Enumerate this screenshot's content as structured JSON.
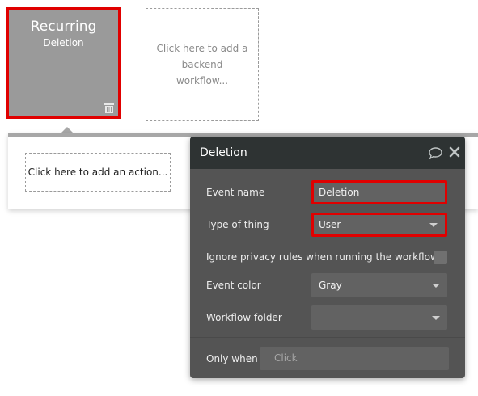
{
  "event_card": {
    "title": "Recurring",
    "subtitle": "Deletion"
  },
  "add_workflow_text": "Click here to add a backend workflow...",
  "add_action_text": "Click here to add an action...",
  "panel": {
    "title": "Deletion",
    "fields": {
      "event_name": {
        "label": "Event name",
        "value": "Deletion"
      },
      "type_of_thing": {
        "label": "Type of thing",
        "value": "User"
      },
      "ignore_privacy": {
        "label": "Ignore privacy rules when running the workflow"
      },
      "event_color": {
        "label": "Event color",
        "value": "Gray"
      },
      "workflow_folder": {
        "label": "Workflow folder",
        "value": ""
      },
      "only_when": {
        "label": "Only when",
        "placeholder": "Click"
      }
    }
  },
  "colors": {
    "highlight": "#e00000",
    "panel_bg": "#545454",
    "panel_header": "#2e3333",
    "event_card_bg": "#9a9a9a"
  }
}
